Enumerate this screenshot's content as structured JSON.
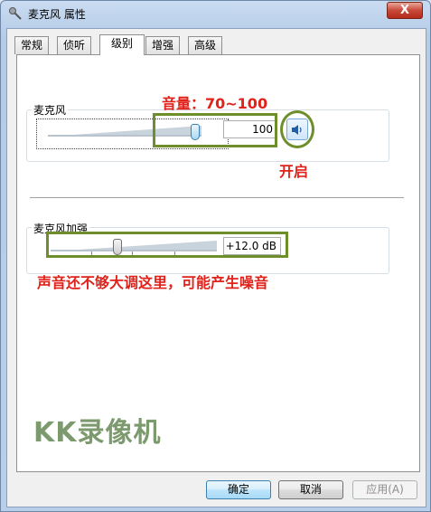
{
  "window": {
    "title": "麦克风 属性",
    "close_label": "X"
  },
  "tabs": [
    {
      "label": "常规"
    },
    {
      "label": "侦听"
    },
    {
      "label": "级别"
    },
    {
      "label": "增强"
    },
    {
      "label": "高级"
    }
  ],
  "active_tab": "级别",
  "microphone": {
    "label": "麦克风",
    "value": "100",
    "level": 100
  },
  "boost": {
    "label": "麦克风加强",
    "value": "+12.0 dB",
    "level_db": 12.0,
    "max_db": 30.0
  },
  "annotations": {
    "volume_hint": "音量：70~100",
    "enable_hint": "开启",
    "boost_hint": "声音还不够大调这里，可能产生噪音"
  },
  "watermark": "KK录像机",
  "buttons": {
    "ok": "确定",
    "cancel": "取消",
    "apply": "应用(A)"
  },
  "colors": {
    "annotation_red": "#e0221b",
    "annotation_green": "#6d8e2a",
    "watermark": "#7c9a6e"
  }
}
